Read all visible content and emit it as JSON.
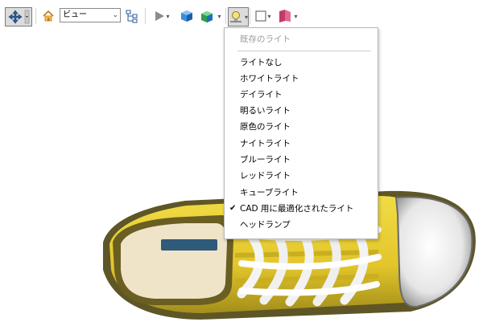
{
  "toolbar": {
    "view_select_value": "ビュー"
  },
  "lighting_menu": {
    "header": "既存のライト",
    "items": [
      {
        "label": "ライトなし",
        "checked": false
      },
      {
        "label": "ホワイトライト",
        "checked": false
      },
      {
        "label": "デイライト",
        "checked": false
      },
      {
        "label": "明るいライト",
        "checked": false
      },
      {
        "label": "原色のライト",
        "checked": false
      },
      {
        "label": "ナイトライト",
        "checked": false
      },
      {
        "label": "ブルーライト",
        "checked": false
      },
      {
        "label": "レッドライト",
        "checked": false
      },
      {
        "label": "キューブライト",
        "checked": false
      },
      {
        "label": "CAD 用に最適化されたライト",
        "checked": true
      },
      {
        "label": "ヘッドランプ",
        "checked": false
      }
    ],
    "check_mark": "✔"
  },
  "icons": [
    "navigation-icon",
    "home-icon",
    "model-tree-icon",
    "play-icon",
    "cube-icon",
    "projection-cube-icon",
    "lighting-icon",
    "background-icon",
    "cross-section-icon"
  ],
  "colors": {
    "shoe_yellow": "#e4cc2a",
    "shoe_dark": "#5a5420",
    "toe_cap": "#ececec",
    "insole": "#f0e6cc",
    "label_blue": "#2f5a7a"
  }
}
